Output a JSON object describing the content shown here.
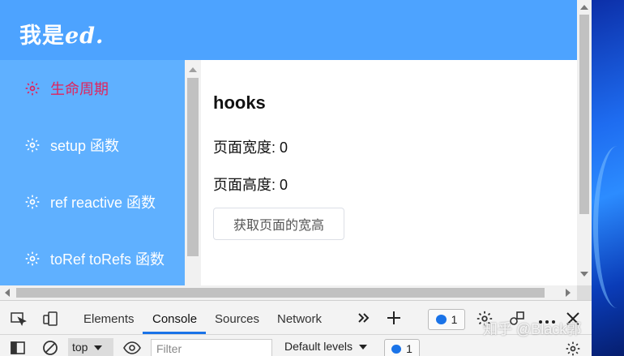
{
  "app": {
    "logo_prefix": "我是",
    "logo_suffix": "ed."
  },
  "sidebar": {
    "items": [
      {
        "label": "生命周期",
        "active": true
      },
      {
        "label": "setup 函数",
        "active": false
      },
      {
        "label": "ref reactive 函数",
        "active": false
      },
      {
        "label": "toRef toRefs 函数",
        "active": false
      }
    ]
  },
  "main": {
    "title": "hooks",
    "width_line": "页面宽度: 0",
    "height_line": "页面高度: 0",
    "button_label": "获取页面的宽高"
  },
  "devtools": {
    "tabs": [
      "Elements",
      "Console",
      "Sources",
      "Network"
    ],
    "active_tab": "Console",
    "issues_count": "1",
    "context": "top",
    "filter_placeholder": "Filter",
    "levels": "Default levels",
    "messages_count": "1"
  },
  "watermark": "知乎 @Black郭",
  "colors": {
    "header": "#4da3ff",
    "sidebar": "#5fb0ff",
    "active_item": "#e0245e",
    "devtools_accent": "#1a73e8"
  },
  "icons": [
    "gear-icon",
    "inspect-icon",
    "device-toggle-icon",
    "more-tabs-icon",
    "plus-icon",
    "settings-icon",
    "customize-icon",
    "more-icon",
    "close-icon",
    "sidebar-toggle-icon",
    "clear-icon",
    "eye-icon"
  ]
}
